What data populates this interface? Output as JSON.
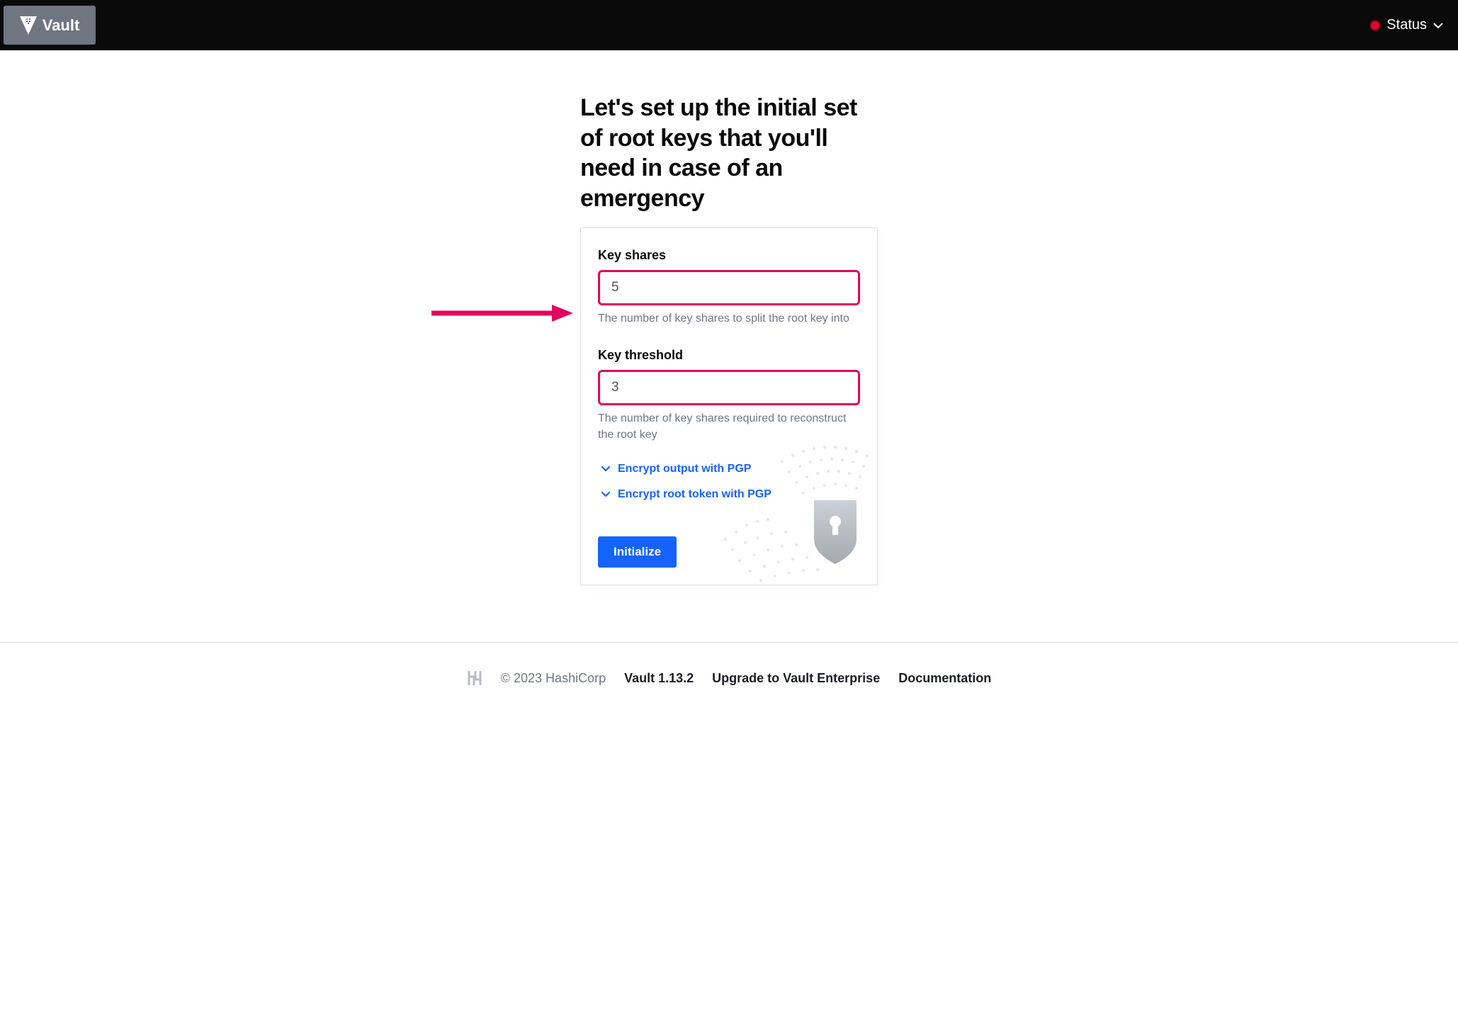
{
  "header": {
    "brand": "Vault",
    "status_label": "Status"
  },
  "page": {
    "heading": "Let's set up the initial set of root keys that you'll need in case of an emergency"
  },
  "form": {
    "key_shares": {
      "label": "Key shares",
      "value": "5",
      "help": "The number of key shares to split the root key into"
    },
    "key_threshold": {
      "label": "Key threshold",
      "value": "3",
      "help": "The number of key shares required to reconstruct the root key"
    },
    "pgp_output_label": "Encrypt output with PGP",
    "pgp_root_label": "Encrypt root token with PGP",
    "submit_label": "Initialize"
  },
  "footer": {
    "copyright": "© 2023 HashiCorp",
    "version": "Vault 1.13.2",
    "upgrade": "Upgrade to Vault Enterprise",
    "docs": "Documentation"
  }
}
